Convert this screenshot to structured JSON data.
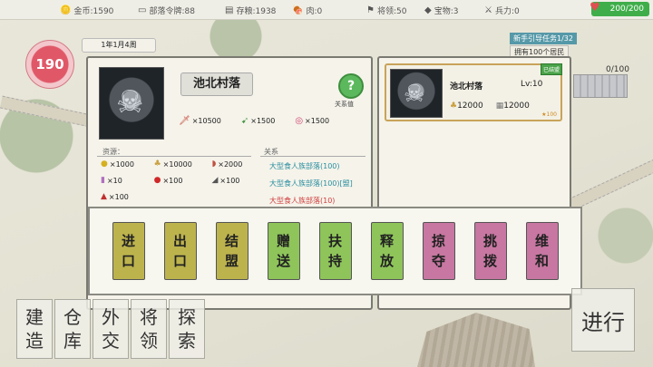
{
  "topbar": {
    "gold": {
      "icon": "gold-coins-icon",
      "label": "金币:1590"
    },
    "tokens": {
      "icon": "tribe-token-icon",
      "label": "部落令牌:88"
    },
    "grain": {
      "icon": "grain-icon",
      "label": "存粮:1938"
    },
    "meat": {
      "icon": "meat-icon",
      "label": "肉:0"
    },
    "totem": {
      "icon": "flag-icon",
      "label": "将领:50"
    },
    "treasure": {
      "icon": "treasure-icon",
      "label": "宝物:3"
    },
    "troops": {
      "icon": "troops-icon",
      "label": "兵力:0"
    },
    "health": {
      "icon": "heart-icon",
      "label": "200/200",
      "color": "#3fae4a"
    }
  },
  "player": {
    "level": "190",
    "date": "1年1月4周"
  },
  "village": {
    "name": "池北村落",
    "relation_label": "关系值",
    "relation_btn": "?",
    "stats": [
      {
        "icon": "sword-icon",
        "value": "×10500"
      },
      {
        "icon": "bow-icon",
        "value": "×1500"
      },
      {
        "icon": "swirl-icon",
        "value": "×1500"
      }
    ],
    "resources_title": "资源：",
    "relations_title": "关系",
    "resources": [
      {
        "icon": "gold-icon",
        "value": "×1000"
      },
      {
        "icon": "wheat-icon",
        "value": "×10000"
      },
      {
        "icon": "meat-icon",
        "value": "×2000"
      },
      {
        "icon": "token-icon",
        "value": "×10"
      },
      {
        "icon": "apple-icon",
        "value": "×100"
      },
      {
        "icon": "cloth-icon",
        "value": "×100"
      },
      {
        "icon": "pot-icon",
        "value": "×100"
      }
    ],
    "relations": [
      "大型食人族部落(100)",
      "大型食人族部落(100)[盟]",
      "大型食人族部落(10)"
    ]
  },
  "card": {
    "name": "池北村落",
    "level": "Lv:10",
    "tag": "已结盟",
    "val1": "12000",
    "val2": "12000",
    "stars": "★100"
  },
  "quest": {
    "title": "新手引导任务1/32",
    "task": "拥有100个居民",
    "ratio": "0/100"
  },
  "actions": [
    {
      "line1": "进",
      "line2": "口",
      "color": "olive"
    },
    {
      "line1": "出",
      "line2": "口",
      "color": "olive"
    },
    {
      "line1": "结",
      "line2": "盟",
      "color": "olive"
    },
    {
      "line1": "赠",
      "line2": "送",
      "color": "green"
    },
    {
      "line1": "扶",
      "line2": "持",
      "color": "green"
    },
    {
      "line1": "释",
      "line2": "放",
      "color": "green"
    },
    {
      "line1": "掠",
      "line2": "夺",
      "color": "pink"
    },
    {
      "line1": "挑",
      "line2": "拨",
      "color": "pink"
    },
    {
      "line1": "维",
      "line2": "和",
      "color": "pink"
    }
  ],
  "bottom": [
    {
      "a": "建",
      "b": "造"
    },
    {
      "a": "仓",
      "b": "库"
    },
    {
      "a": "外",
      "b": "交"
    },
    {
      "a": "将",
      "b": "领"
    },
    {
      "a": "探",
      "b": "索"
    }
  ],
  "go_label": "进行"
}
